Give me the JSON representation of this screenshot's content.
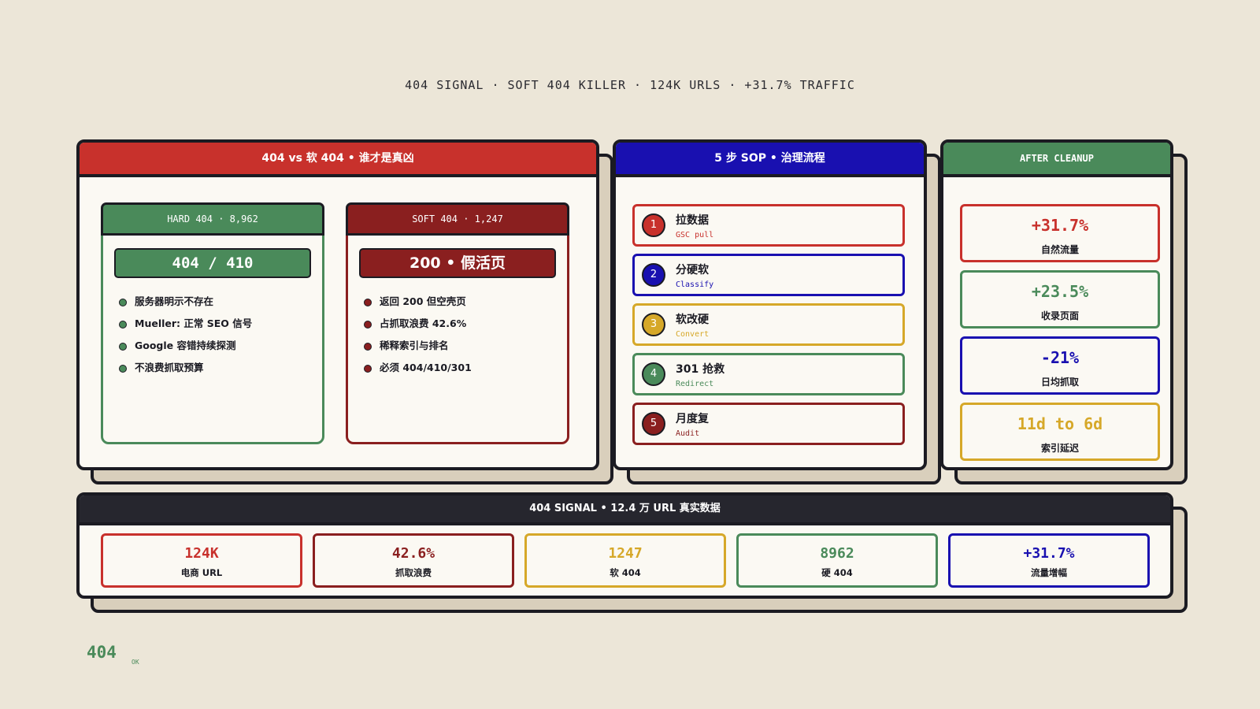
{
  "header_line": "404 SIGNAL · SOFT 404 KILLER · 124K URLS · +31.7% TRAFFIC",
  "colors": {
    "red": "#c8312c",
    "dark_red": "#8a1f1f",
    "blue": "#1910b0",
    "green": "#4a8a5a",
    "gold": "#d6a829",
    "ink": "#1b1b22",
    "paper": "#ece6d8"
  },
  "compare": {
    "title": "404 vs 软 404 • 谁才是真凶",
    "hard": {
      "head": "HARD 404 · 8,962",
      "big": "404 / 410",
      "items": [
        "服务器明示不存在",
        "Mueller: 正常 SEO 信号",
        "Google 容错持续探测",
        "不浪费抓取预算"
      ]
    },
    "soft": {
      "head": "SOFT 404 · 1,247",
      "big": "200 • 假活页",
      "items": [
        "返回 200 但空壳页",
        "占抓取浪费 42.6%",
        "稀释索引与排名",
        "必须 404/410/301"
      ]
    }
  },
  "sop": {
    "title": "5 步 SOP • 治理流程",
    "steps": [
      {
        "num": "1",
        "title": "拉数据",
        "sub": "GSC pull"
      },
      {
        "num": "2",
        "title": "分硬软",
        "sub": "Classify"
      },
      {
        "num": "3",
        "title": "软改硬",
        "sub": "Convert"
      },
      {
        "num": "4",
        "title": "301 抢救",
        "sub": "Redirect"
      },
      {
        "num": "5",
        "title": "月度复",
        "sub": "Audit"
      }
    ]
  },
  "after": {
    "title": "AFTER CLEANUP",
    "metrics": [
      {
        "value": "+31.7%",
        "label": "自然流量"
      },
      {
        "value": "+23.5%",
        "label": "收录页面"
      },
      {
        "value": "-21%",
        "label": "日均抓取"
      },
      {
        "value": "11d to 6d",
        "label": "索引延迟"
      }
    ]
  },
  "stats": {
    "title": "404 SIGNAL • 12.4 万 URL 真实数据",
    "items": [
      {
        "value": "124K",
        "label": "电商 URL"
      },
      {
        "value": "42.6%",
        "label": "抓取浪费"
      },
      {
        "value": "1247",
        "label": "软 404"
      },
      {
        "value": "8962",
        "label": "硬 404"
      },
      {
        "value": "+31.7%",
        "label": "流量增幅"
      }
    ]
  },
  "footer": {
    "code": "404",
    "status": "OK"
  }
}
